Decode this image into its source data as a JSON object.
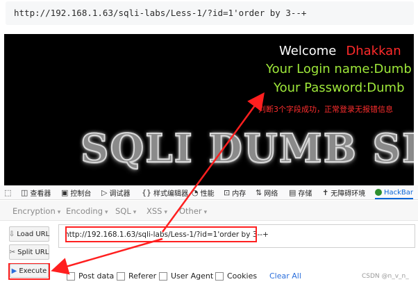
{
  "address_bar": {
    "url": "http://192.168.1.63/sqli-labs/Less-1/?id=1'order by 3--+"
  },
  "page": {
    "welcome": "Welcome",
    "user_tag": "Dhakkan",
    "login_line": "Your Login name:Dumb",
    "password_line": "Your Password:Dumb",
    "annotation": "判断3个字段成功，正常登录无报错信息",
    "banner": "SQLI DUMB SE"
  },
  "devtools": {
    "tools": [
      {
        "label": "",
        "icon": "pick-element-icon"
      },
      {
        "label": "查看器",
        "icon": "inspector-icon"
      },
      {
        "label": "控制台",
        "icon": "console-icon"
      },
      {
        "label": "调试器",
        "icon": "debugger-icon"
      },
      {
        "label": "样式编辑器",
        "icon": "style-editor-icon"
      },
      {
        "label": "性能",
        "icon": "performance-icon"
      },
      {
        "label": "内存",
        "icon": "memory-icon"
      },
      {
        "label": "网络",
        "icon": "network-icon"
      },
      {
        "label": "存储",
        "icon": "storage-icon"
      },
      {
        "label": "无障碍环境",
        "icon": "accessibility-icon"
      },
      {
        "label": "HackBar",
        "icon": "hackbar-icon"
      }
    ]
  },
  "hackbar": {
    "menu": [
      "Encryption",
      "Encoding",
      "SQL",
      "XSS",
      "Other"
    ],
    "buttons": {
      "load": "Load URL",
      "split": "Split URL",
      "execute": "Execute"
    },
    "url_value": "http://192.168.1.63/sqli-labs/Less-1/?id=1'order by 3--+",
    "options": [
      "Post data",
      "Referer",
      "User Agent",
      "Cookies"
    ],
    "clear_all": "Clear All"
  },
  "watermark": "CSDN @n_v_n_",
  "colors": {
    "highlight": "#ff1f1f",
    "green_text": "#9ee83a",
    "link": "#2a6edb"
  }
}
